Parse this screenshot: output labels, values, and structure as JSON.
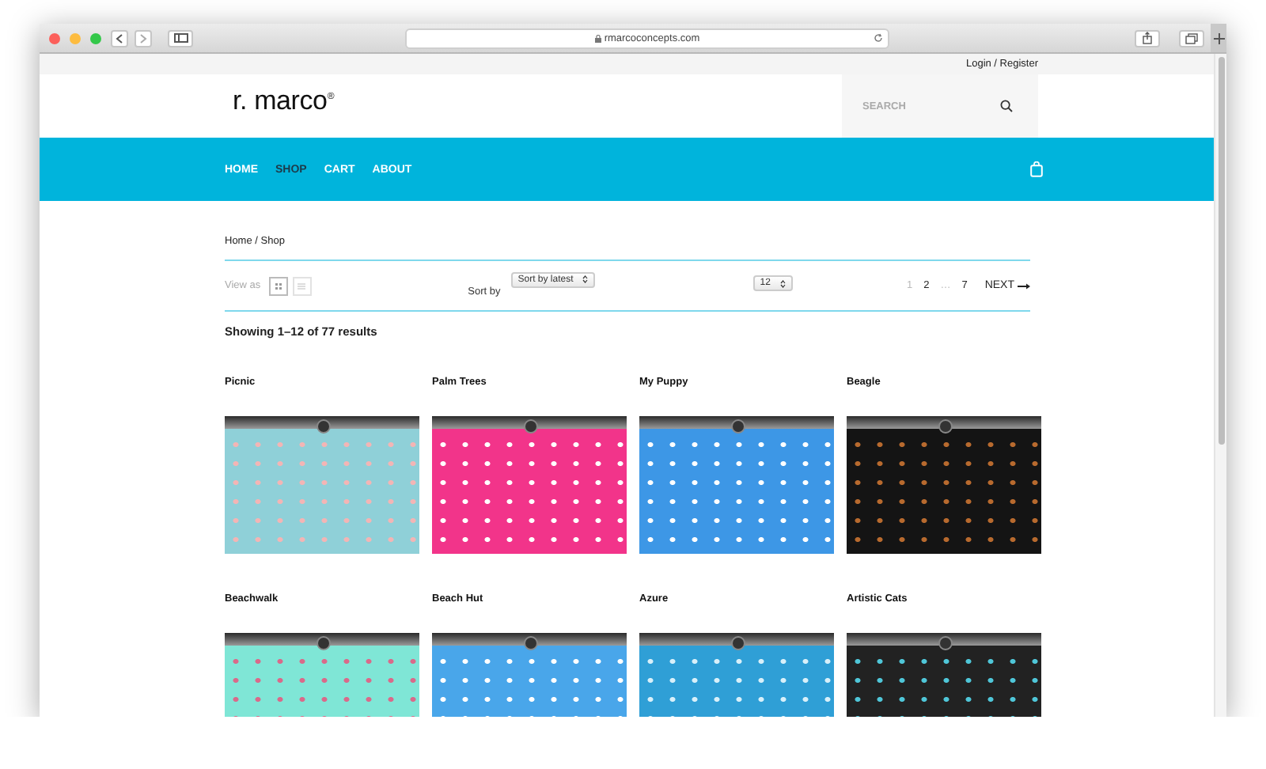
{
  "browser": {
    "url": "rmarcoconcepts.com"
  },
  "top_bar": {
    "account_link": "Login / Register"
  },
  "header": {
    "logo": "r. marco$^{®}$",
    "search": {
      "placeholder": "SEARCH"
    }
  },
  "nav": [
    {
      "label": "HOME",
      "selected": false
    },
    {
      "label": "SHOP",
      "selected": true
    },
    {
      "label": "CART",
      "selected": false
    },
    {
      "label": "ABOUT",
      "selected": false
    }
  ],
  "breadcrumb": "Home / Shop",
  "toolbar": {
    "view_label": "View as",
    "views": [
      {
        "kind": "grid",
        "selected": true
      },
      {
        "kind": "list",
        "selected": false
      }
    ],
    "sort_label": "Sort by",
    "sort_value": "Sort by latest",
    "per_page": "12",
    "pagination": [
      {
        "kind": "page",
        "label": "1",
        "selected": true
      },
      {
        "kind": "page",
        "label": "2",
        "selected": false
      },
      {
        "kind": "gap",
        "label": "…"
      },
      {
        "kind": "page",
        "label": "7",
        "selected": false
      }
    ],
    "next": "NEXT"
  },
  "result_count": "Showing 1–12 of 77 results",
  "products": [
    {
      "name": "Picnic"
    },
    {
      "name": "Palm Trees"
    },
    {
      "name": "My Puppy"
    },
    {
      "name": "Beagle"
    },
    {
      "name": "Beachwalk"
    },
    {
      "name": "Beach Hut"
    },
    {
      "name": "Azure"
    },
    {
      "name": "Artistic Cats"
    }
  ]
}
